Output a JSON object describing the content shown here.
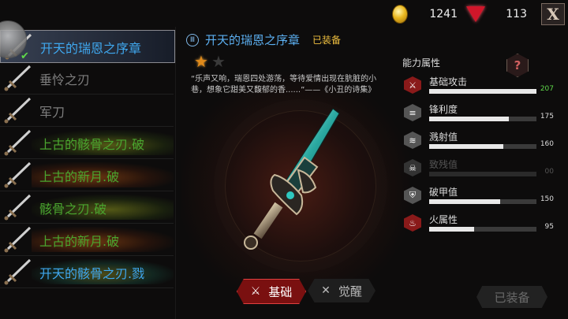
{
  "resources": {
    "gold": "1241",
    "gems": "113"
  },
  "weapon_list": [
    {
      "name": "开天的瑞恩之序章",
      "color": "#3fa7ee",
      "selected": true
    },
    {
      "name": "垂怜之刃",
      "color": "#7e7e7e"
    },
    {
      "name": "军刀",
      "color": "#7e7e7e"
    },
    {
      "name": "上古的骸骨之刃.破",
      "color": "#4aa52f"
    },
    {
      "name": "上古的新月.破",
      "color": "#4aa52f"
    },
    {
      "name": "骸骨之刃.破",
      "color": "#4aa52f"
    },
    {
      "name": "上古的新月.破",
      "color": "#4aa52f"
    },
    {
      "name": "开天的骸骨之刃.戮",
      "color": "#3fa7ee"
    }
  ],
  "detail": {
    "name": "开天的瑞恩之序章",
    "equipped_label": "已装备",
    "stars_filled": 1,
    "stars_total": 2,
    "quote": "“乐声又响，瑞恩四处游荡，等待爱情出现在肮脏的小巷，想象它甜美又馥郁的香......”——《小丑的诗集》"
  },
  "stats": {
    "title": "能力属性",
    "items": [
      {
        "label": "基础攻击",
        "value": "207",
        "fill": 1.0,
        "icon": "sword-icon",
        "icon_color": "#8a1a1a",
        "dim": false
      },
      {
        "label": "锋利度",
        "value": "175",
        "fill": 0.74,
        "icon": "slash-icon",
        "icon_color": "#555555",
        "dim": false
      },
      {
        "label": "溅射值",
        "value": "160",
        "fill": 0.69,
        "icon": "splash-icon",
        "icon_color": "#555555",
        "dim": false
      },
      {
        "label": "致残值",
        "value": "00",
        "fill": 0.0,
        "icon": "cripple-icon",
        "icon_color": "#333333",
        "dim": true
      },
      {
        "label": "破甲值",
        "value": "150",
        "fill": 0.66,
        "icon": "shield-break-icon",
        "icon_color": "#555555",
        "dim": false
      },
      {
        "label": "火属性",
        "value": "95",
        "fill": 0.42,
        "icon": "fire-icon",
        "icon_color": "#8a1a1a",
        "dim": false
      }
    ]
  },
  "tabs": {
    "basic": "基础",
    "awaken": "觉醒"
  },
  "equip_button": "已装备",
  "close_label": "X",
  "help_label": "?"
}
